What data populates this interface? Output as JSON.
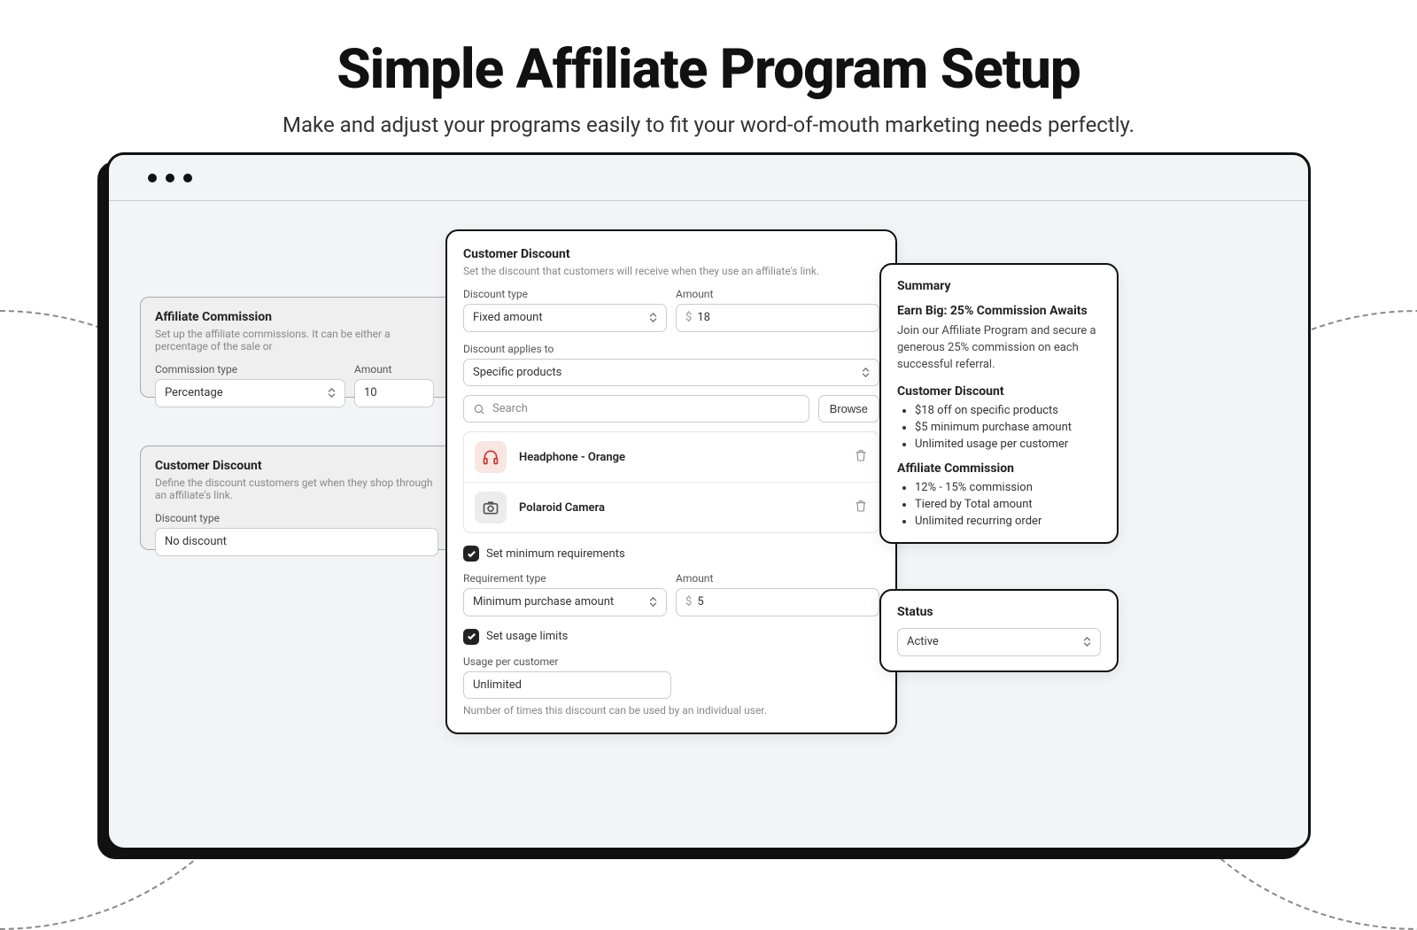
{
  "hero": {
    "title": "Simple Affiliate Program Setup",
    "subtitle": "Make and adjust your programs easily to fit your word-of-mouth marketing needs perfectly."
  },
  "affiliateCommission": {
    "title": "Affiliate Commission",
    "description": "Set up the affiliate commissions. It can be either a percentage of the sale or",
    "commissionType": {
      "label": "Commission type",
      "value": "Percentage"
    },
    "amount": {
      "label": "Amount",
      "value": "10"
    }
  },
  "customerDiscountBack": {
    "title": "Customer Discount",
    "description": "Define the discount customers get when they shop through an affiliate's link.",
    "discountType": {
      "label": "Discount type",
      "value": "No discount"
    }
  },
  "customerDiscount": {
    "title": "Customer Discount",
    "description": "Set the discount that customers will receive when they use an affiliate's link.",
    "discountType": {
      "label": "Discount type",
      "value": "Fixed amount"
    },
    "amount": {
      "label": "Amount",
      "prefix": "$",
      "value": "18"
    },
    "appliesTo": {
      "label": "Discount applies to",
      "value": "Specific products"
    },
    "search": {
      "placeholder": "Search"
    },
    "browseLabel": "Browse",
    "products": [
      {
        "name": "Headphone - Orange",
        "icon": "headphones",
        "thumbClass": "thumb-orange"
      },
      {
        "name": "Polaroid Camera",
        "icon": "camera",
        "thumbClass": "thumb-grey"
      }
    ],
    "minRequirements": {
      "checkboxLabel": "Set minimum requirements",
      "typeLabel": "Requirement type",
      "typeValue": "Minimum purchase amount",
      "amountLabel": "Amount",
      "amountPrefix": "$",
      "amountValue": "5"
    },
    "usageLimits": {
      "checkboxLabel": "Set usage limits",
      "perCustomerLabel": "Usage per customer",
      "perCustomerValue": "Unlimited",
      "helper": "Number of times this discount can be used by an individual user."
    }
  },
  "summary": {
    "title": "Summary",
    "headline": "Earn Big: 25% Commission Awaits",
    "body": "Join our Affiliate Program and secure a generous 25% commission on each successful referral.",
    "customerDiscount": {
      "title": "Customer Discount",
      "items": [
        "$18 off on specific products",
        "$5 minimum purchase amount",
        "Unlimited usage per customer"
      ]
    },
    "affiliateCommission": {
      "title": "Affiliate Commission",
      "items": [
        "12% - 15% commission",
        "Tiered by Total amount",
        "Unlimited recurring order"
      ]
    }
  },
  "status": {
    "title": "Status",
    "value": "Active"
  }
}
